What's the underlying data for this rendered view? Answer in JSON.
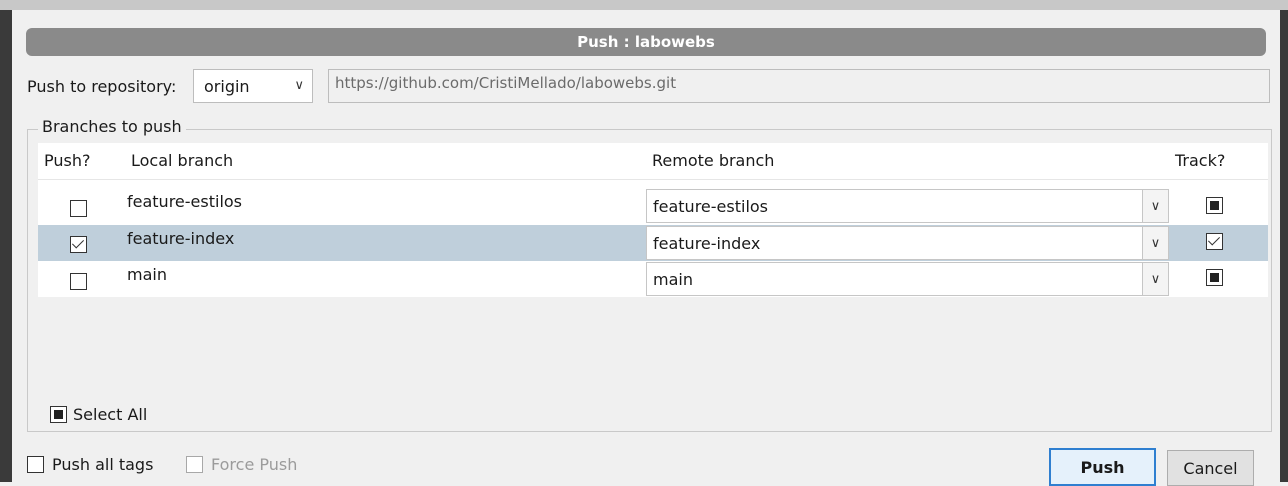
{
  "dialog": {
    "title": "Push : labowebs"
  },
  "repository": {
    "label": "Push to repository:",
    "selected": "origin",
    "url": "https://github.com/CristiMellado/labowebs.git"
  },
  "branches": {
    "group_label": "Branches to push",
    "headers": {
      "push": "Push?",
      "local": "Local branch",
      "remote": "Remote branch",
      "track": "Track?"
    },
    "rows": [
      {
        "local": "feature-estilos",
        "remote": "feature-estilos",
        "push": false,
        "track": "partial",
        "selected": false
      },
      {
        "local": "feature-index",
        "remote": "feature-index",
        "push": true,
        "track": "checked",
        "selected": true
      },
      {
        "local": "main",
        "remote": "main",
        "push": false,
        "track": "partial",
        "selected": false
      }
    ]
  },
  "select_all": {
    "label": "Select All",
    "state": "partial"
  },
  "options": {
    "push_all_tags": {
      "label": "Push all tags",
      "checked": false
    },
    "force_push": {
      "label": "Force Push",
      "checked": false,
      "disabled": true
    }
  },
  "buttons": {
    "push": "Push",
    "cancel": "Cancel"
  },
  "icons": {
    "dropdown": "chevron-down-icon"
  },
  "colors": {
    "selected_row": "#bfcfdb",
    "title_bar": "#8a8a8a",
    "default_button_border": "#2f7fd0"
  }
}
